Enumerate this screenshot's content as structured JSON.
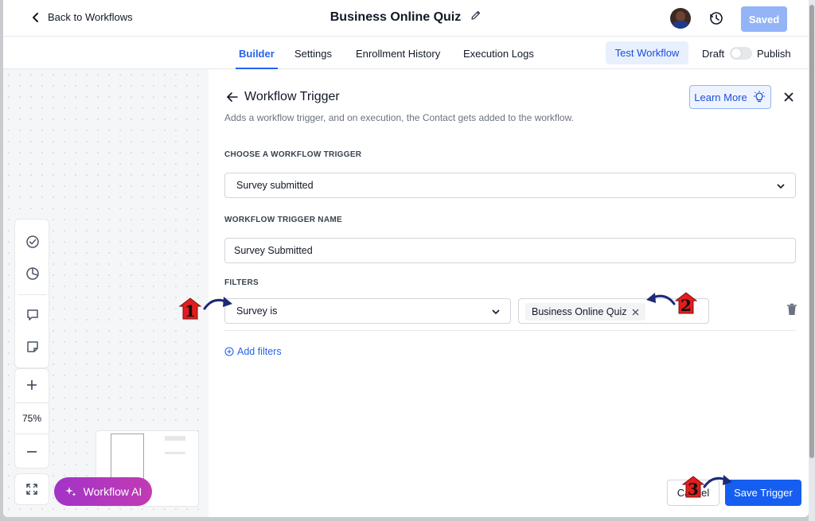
{
  "header": {
    "back_label": "Back to Workflows",
    "title": "Business Online Quiz",
    "saved_label": "Saved"
  },
  "tabs": [
    {
      "label": "Builder",
      "active": true
    },
    {
      "label": "Settings",
      "active": false
    },
    {
      "label": "Enrollment History",
      "active": false
    },
    {
      "label": "Execution Logs",
      "active": false
    }
  ],
  "toolbar": {
    "test_label": "Test Workflow",
    "draft_label": "Draft",
    "publish_label": "Publish",
    "publish_enabled": false
  },
  "canvas": {
    "zoom_level": "75%",
    "ai_label": "Workflow AI",
    "icons": [
      "check-circle-icon",
      "pie-chart-icon",
      "comment-icon",
      "sticky-note-icon",
      "plus-icon",
      "minus-icon",
      "fit-screen-icon",
      "sparkle-icon"
    ]
  },
  "panel": {
    "title": "Workflow Trigger",
    "description": "Adds a workflow trigger, and on execution, the Contact gets added to the workflow.",
    "learn_more_label": "Learn More",
    "trigger_label": "CHOOSE A WORKFLOW TRIGGER",
    "trigger_value": "Survey submitted",
    "name_label": "WORKFLOW TRIGGER NAME",
    "name_value": "Survey Submitted",
    "filters_label": "FILTERS",
    "filter_field": "Survey is",
    "filter_chip": "Business Online Quiz",
    "add_filters_label": "Add filters",
    "cancel_label": "Cancel",
    "save_label": "Save Trigger"
  },
  "annotations": [
    {
      "number": "1"
    },
    {
      "number": "2"
    },
    {
      "number": "3"
    }
  ],
  "colors": {
    "accent": "#2563eb",
    "primary_button": "#155eef",
    "saved_button": "#93b4f6",
    "ai_gradient_start": "#a234c7",
    "ai_gradient_end": "#c13bb3",
    "marker_red": "#e11d1d",
    "arrow_navy": "#1e2a78"
  }
}
